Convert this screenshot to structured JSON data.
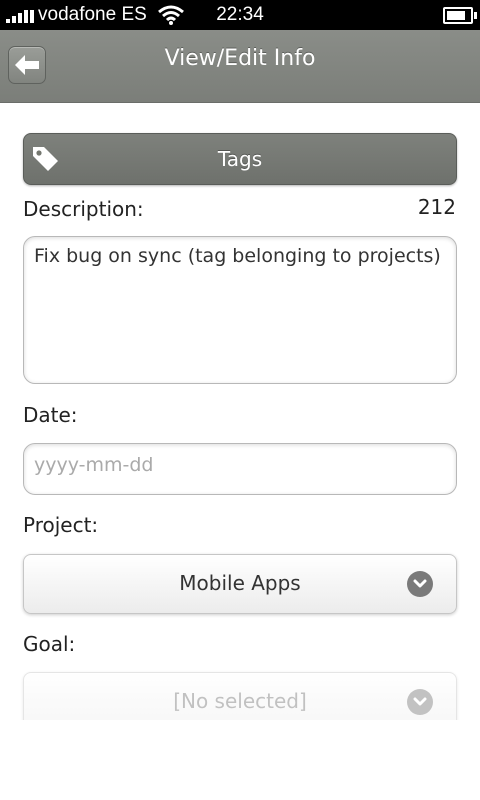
{
  "status_bar": {
    "carrier": "vodafone ES",
    "time": "22:34"
  },
  "header": {
    "title": "View/Edit Info",
    "back_icon": "arrow-left-icon"
  },
  "tags_button": {
    "label": "Tags",
    "icon": "tag-icon"
  },
  "description": {
    "label": "Description:",
    "char_count": "212",
    "value": "Fix bug on sync (tag belonging to projects)"
  },
  "date": {
    "label": "Date:",
    "placeholder": "yyyy-mm-dd",
    "value": ""
  },
  "project": {
    "label": "Project:",
    "selected": "Mobile Apps"
  },
  "goal": {
    "label": "Goal:",
    "selected": "[No selected]"
  },
  "colors": {
    "header": "#7b7e79",
    "tags_button": "#74776f",
    "status_bar": "#000000"
  }
}
